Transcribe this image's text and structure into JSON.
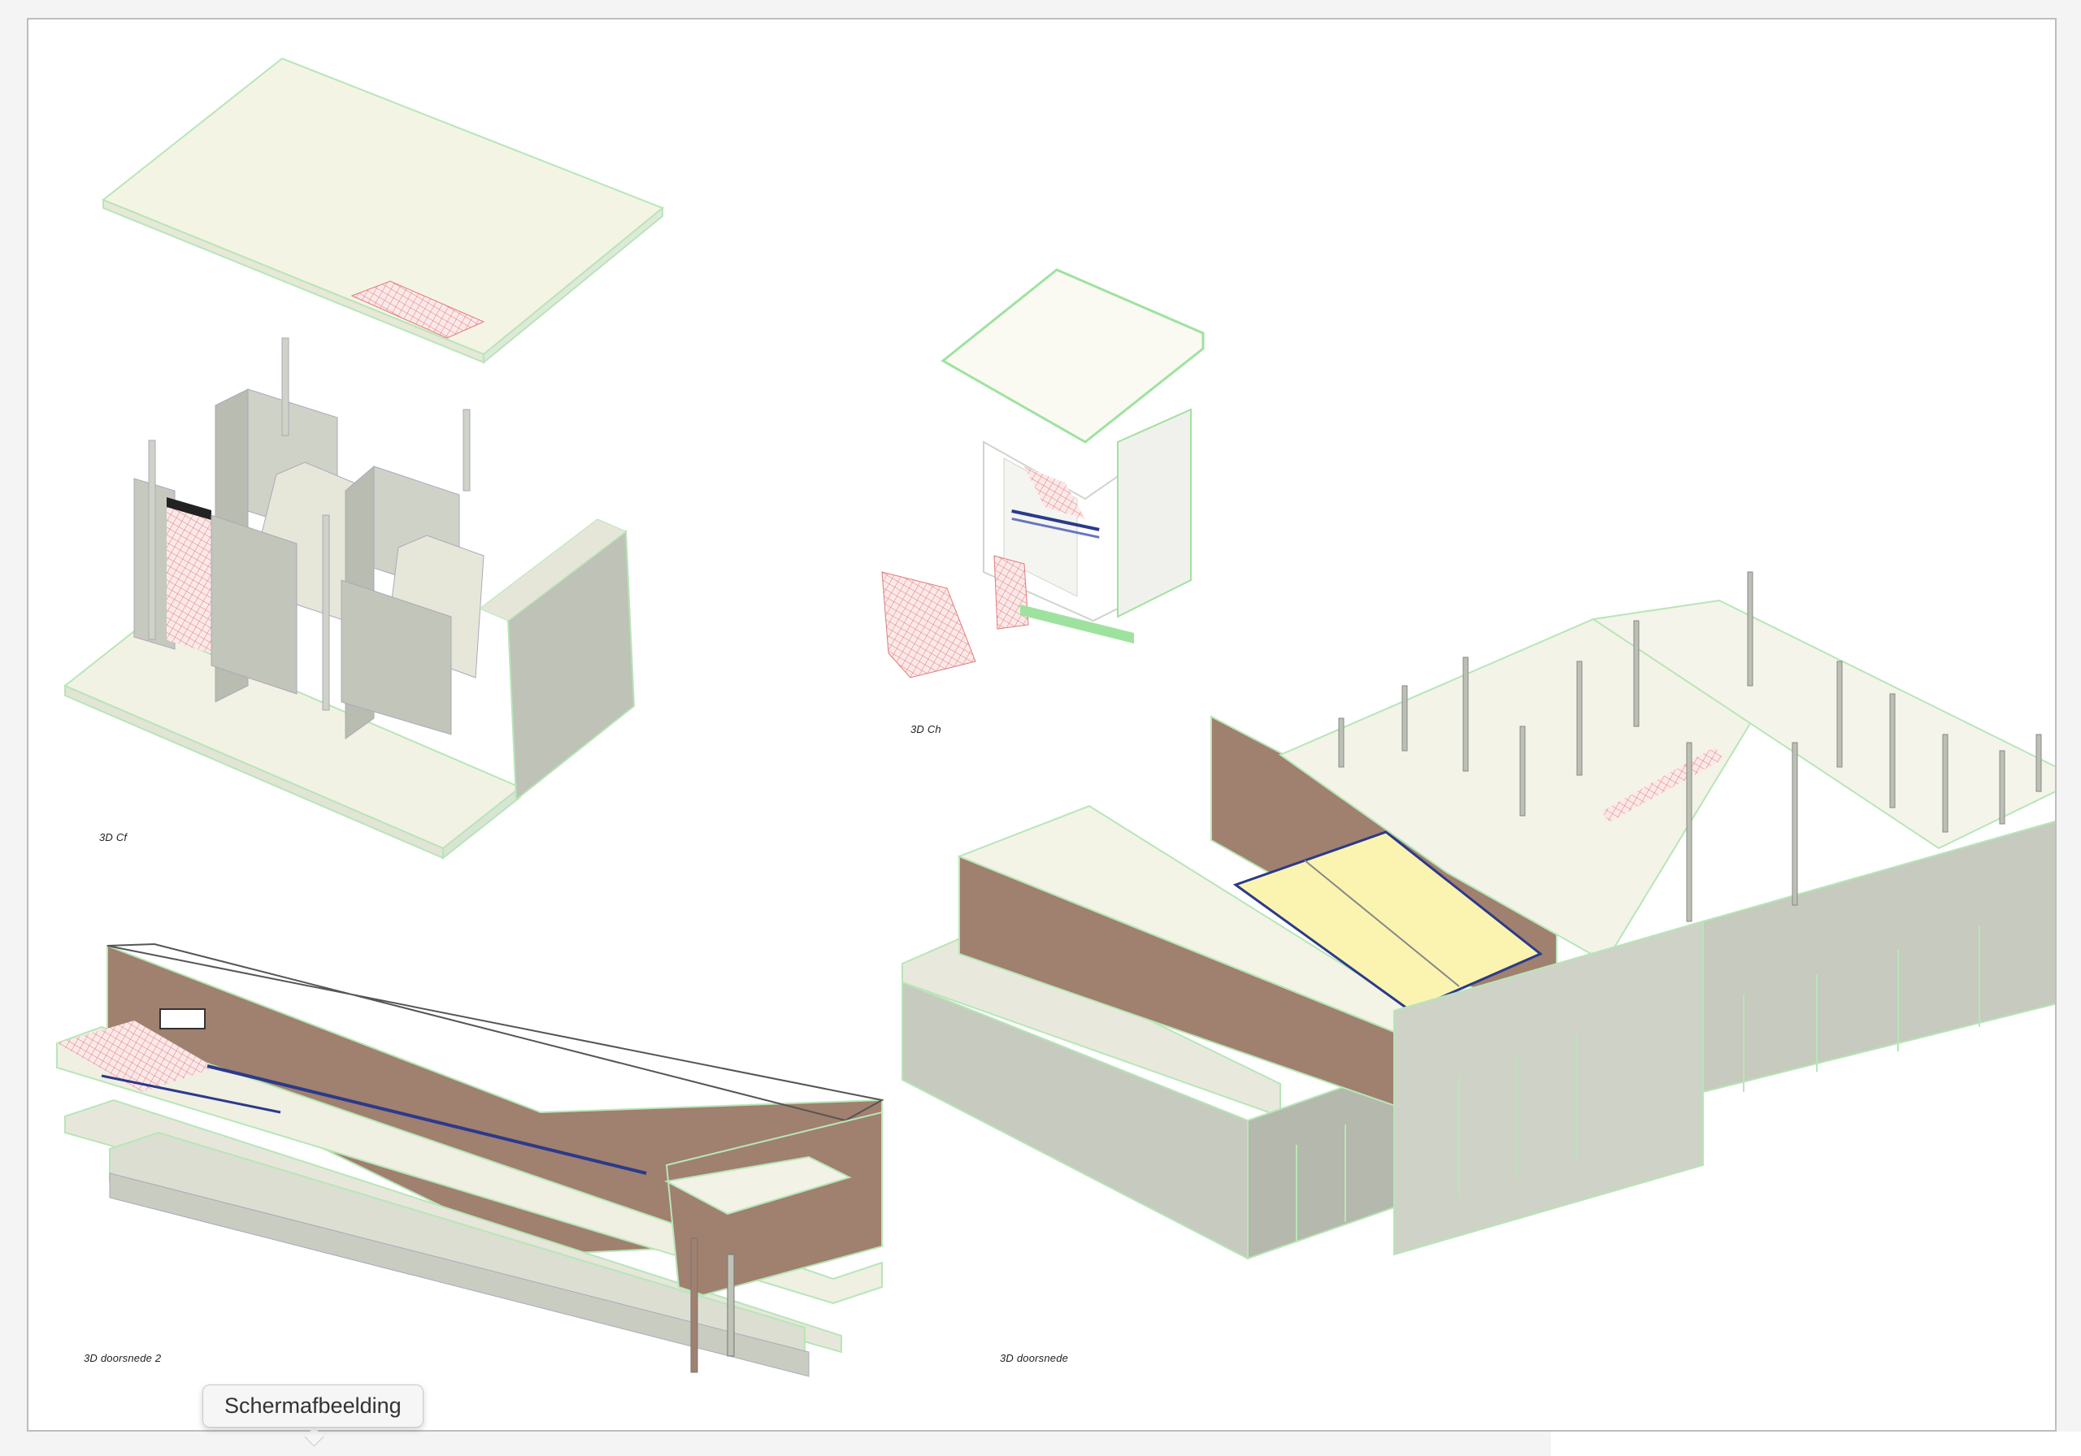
{
  "sheet": {
    "views": [
      {
        "id": "3d-cf",
        "label": "3D Cf"
      },
      {
        "id": "3d-ch",
        "label": "3D Ch"
      },
      {
        "id": "3d-doorsnede-2",
        "label": "3D doorsnede 2"
      },
      {
        "id": "3d-doorsnede",
        "label": "3D doorsnede"
      }
    ]
  },
  "tooltip": {
    "text": "Schermafbeelding"
  },
  "colors": {
    "slab": "#f2f2e2",
    "slab_edge": "#bde8bd",
    "wall": "#c9cdc2",
    "wall_dark": "#a9ada3",
    "brick": "#9c7b6f",
    "hatch": "#e88a8a",
    "glass": "#fbf4b0",
    "beam": "#2b3a8a"
  }
}
